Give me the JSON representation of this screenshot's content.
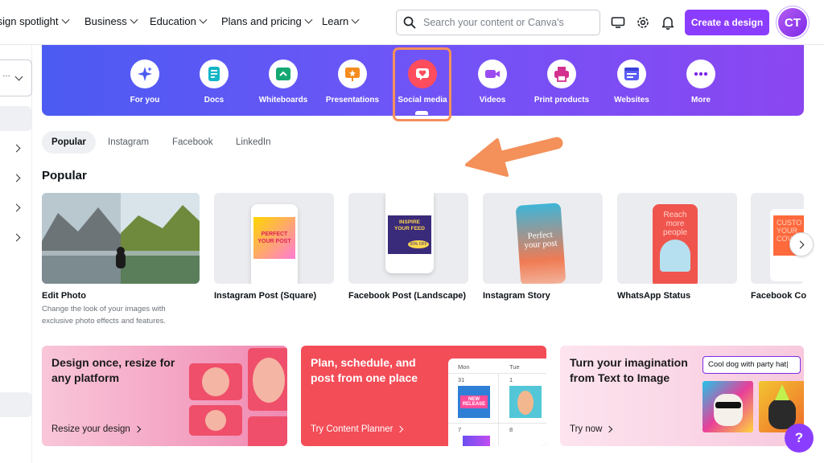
{
  "nav": {
    "items": [
      {
        "label": "Design spotlight"
      },
      {
        "label": "Business"
      },
      {
        "label": "Education"
      },
      {
        "label": "Plans and pricing"
      },
      {
        "label": "Learn"
      }
    ],
    "search_placeholder": "Search your content or Canva's",
    "create_label": "Create a design",
    "avatar_initials": "CT"
  },
  "categories": [
    {
      "label": "For you",
      "icon": "sparkle-icon",
      "color": "#4b5bf2"
    },
    {
      "label": "Docs",
      "icon": "doc-icon",
      "color": "#13b5c7"
    },
    {
      "label": "Whiteboards",
      "icon": "whiteboard-icon",
      "color": "#14a873"
    },
    {
      "label": "Presentations",
      "icon": "presentation-icon",
      "color": "#f58c1f"
    },
    {
      "label": "Social media",
      "icon": "heart-icon",
      "color": "#ff4d5e"
    },
    {
      "label": "Videos",
      "icon": "video-icon",
      "color": "#9a4cf0"
    },
    {
      "label": "Print products",
      "icon": "printer-icon",
      "color": "#d3308f"
    },
    {
      "label": "Websites",
      "icon": "website-icon",
      "color": "#5b5ef6"
    },
    {
      "label": "More",
      "icon": "more-icon",
      "color": "#7d2ae8"
    }
  ],
  "tabs": [
    {
      "label": "Popular"
    },
    {
      "label": "Instagram"
    },
    {
      "label": "Facebook"
    },
    {
      "label": "LinkedIn"
    }
  ],
  "section_title": "Popular",
  "templates": [
    {
      "label": "Edit Photo",
      "desc": "Change the look of your images with exclusive photo effects and features."
    },
    {
      "label": "Instagram Post (Square)",
      "thumb_text": "PERFECT YOUR POST"
    },
    {
      "label": "Facebook Post (Landscape)",
      "thumb_text": "INSPIRE YOUR FEED",
      "badge": "30% OFF"
    },
    {
      "label": "Instagram Story",
      "thumb_text": "Perfect your post"
    },
    {
      "label": "WhatsApp Status",
      "thumb_text": "Reach more people"
    },
    {
      "label": "Facebook Co",
      "thumb_text": "CUSTO YOUR COVE"
    }
  ],
  "promos": [
    {
      "title": "Design once, resize for any platform",
      "link": "Resize your design"
    },
    {
      "title": "Plan, schedule, and post from one place",
      "link": "Try Content Planner",
      "days": [
        "Mon",
        "Tue"
      ],
      "dates": [
        "31",
        "1",
        "7",
        "8"
      ],
      "badge": "NEW RELEASE"
    },
    {
      "title": "Turn your imagination from Text to Image",
      "link": "Try now",
      "prompt": "Cool dog with party hat"
    }
  ],
  "help_label": "?",
  "colors": {
    "accent": "#8b3dff",
    "highlight": "#f4905a"
  }
}
